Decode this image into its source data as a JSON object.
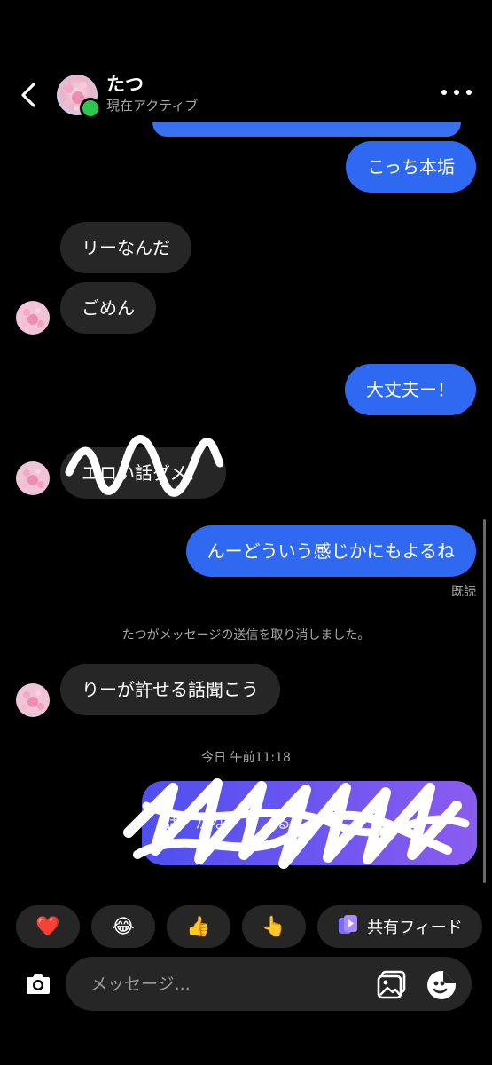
{
  "header": {
    "name": "たつ",
    "status": "現在アクティブ"
  },
  "messages": [
    {
      "side": "out",
      "text": "こっち本垢"
    },
    {
      "side": "in",
      "text": "リーなんだ"
    },
    {
      "side": "in",
      "text": "ごめん"
    },
    {
      "side": "out",
      "text": "大丈夫ー！"
    },
    {
      "side": "in",
      "text": "エロい話ダメ？",
      "scribbled": true
    },
    {
      "side": "out",
      "text": "んーどういう感じかにもよるね"
    },
    {
      "side": "in",
      "text": "りーが許せる話聞こう"
    },
    {
      "side": "out",
      "text": "話　かな　ら　る　あ",
      "scribbled": true
    }
  ],
  "read_receipt": "既読",
  "system_notice": "たつがメッセージの送信を取り消しました。",
  "timestamp": "今日 午前11:18",
  "reactions": {
    "heart": "❤️",
    "laugh": "😂",
    "thumbs": "👍",
    "point": "👆",
    "shared_feed": "共有フィード"
  },
  "composer": {
    "placeholder": "メッセージ..."
  },
  "colors": {
    "outgoing": "#3069f1",
    "incoming": "#262626",
    "online": "#2ac84f",
    "background": "#000000"
  }
}
